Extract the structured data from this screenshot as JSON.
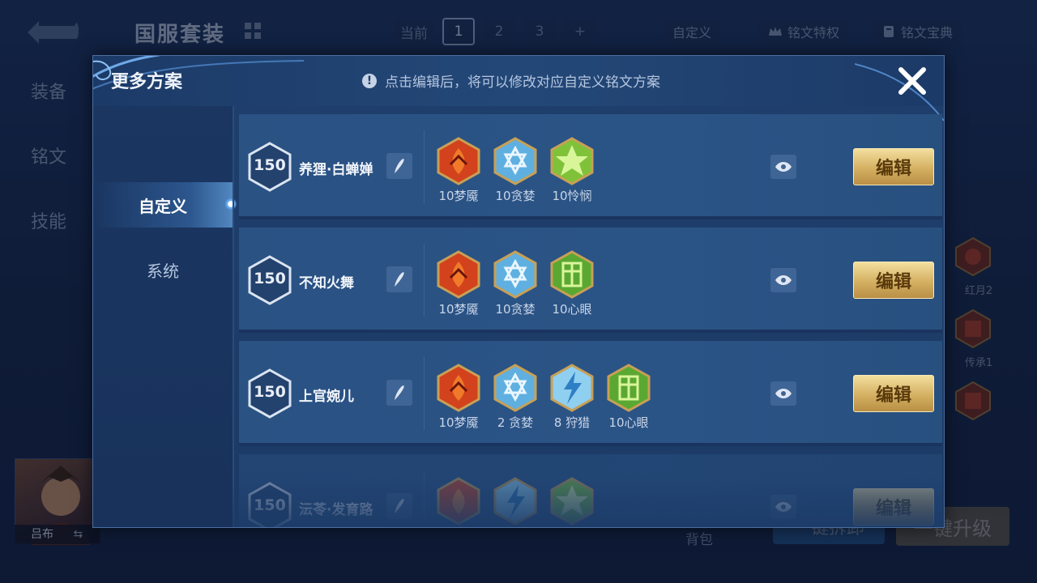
{
  "background": {
    "title": "国服套装",
    "tabs": [
      "当前",
      "1",
      "2",
      "3",
      "+"
    ],
    "active_tab_index": 1,
    "custom_label": "自定义",
    "rune_privilege_label": "铭文特权",
    "rune_book_label": "铭文宝典",
    "side_nav": [
      "装备",
      "铭文",
      "技能"
    ],
    "hero_name": "吕布",
    "right_runes": [
      {
        "label": "红月2"
      },
      {
        "label": "传承1"
      },
      {
        "label": ""
      }
    ],
    "bag_label": "背包",
    "btn_left_label": "一键拆卸",
    "btn_right_label": "一键升级"
  },
  "modal": {
    "title": "更多方案",
    "hint": "点击编辑后，将可以修改对应自定义铭文方案",
    "tabs": [
      {
        "label": "自定义",
        "active": true
      },
      {
        "label": "系统",
        "active": false
      }
    ],
    "edit_label": "编辑",
    "presets": [
      {
        "level": "150",
        "name": "养狸·白蝉婵",
        "runes": [
          {
            "label": "10梦魇",
            "type": "red"
          },
          {
            "label": "10贪婪",
            "type": "blue"
          },
          {
            "label": "10怜悯",
            "type": "green-star"
          }
        ]
      },
      {
        "level": "150",
        "name": "不知火舞",
        "runes": [
          {
            "label": "10梦魇",
            "type": "red"
          },
          {
            "label": "10贪婪",
            "type": "blue"
          },
          {
            "label": "10心眼",
            "type": "green-gate"
          }
        ]
      },
      {
        "level": "150",
        "name": "上官婉儿",
        "runes": [
          {
            "label": "10梦魇",
            "type": "red"
          },
          {
            "label": "2 贪婪",
            "type": "blue"
          },
          {
            "label": "8 狩猎",
            "type": "blue-bolt"
          },
          {
            "label": "10心眼",
            "type": "green-gate"
          }
        ]
      },
      {
        "level": "150",
        "name": "沄苓·发育路",
        "runes": [
          {
            "label": "",
            "type": "red"
          },
          {
            "label": "",
            "type": "blue-bolt"
          },
          {
            "label": "",
            "type": "green-star"
          }
        ]
      }
    ]
  },
  "colors": {
    "modal_bg": "#1f3f6c",
    "row_bg": "#2a5283",
    "gold_button": "#d4b062",
    "rune_red": "#d2421c",
    "rune_blue": "#5fb0e0",
    "rune_green": "#7fc23a"
  }
}
